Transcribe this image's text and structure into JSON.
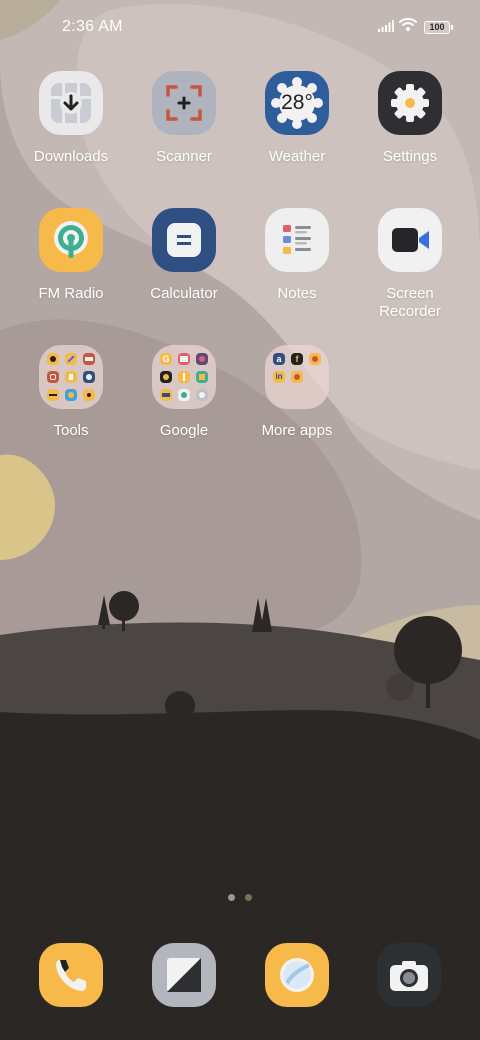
{
  "status_bar": {
    "time": "2:36 AM",
    "battery": "100",
    "icons": [
      "signal-icon",
      "wifi-icon",
      "battery-icon"
    ]
  },
  "home": {
    "apps": [
      {
        "label": "Downloads",
        "icon": "download-icon",
        "color": "#e9e9e9"
      },
      {
        "label": "Scanner",
        "icon": "scanner-icon",
        "color": "#aeb3bd"
      },
      {
        "label": "Weather",
        "icon": "weather-sun-icon",
        "color": "#2f5d9c",
        "value": "28°"
      },
      {
        "label": "Settings",
        "icon": "gear-icon",
        "color": "#2d2f33"
      },
      {
        "label": "FM Radio",
        "icon": "radio-icon",
        "color": "#f6b94a"
      },
      {
        "label": "Calculator",
        "icon": "calculator-icon",
        "color": "#2f4f82"
      },
      {
        "label": "Notes",
        "icon": "notes-icon",
        "color": "#efefef"
      },
      {
        "label": "Screen Recorder",
        "label_line1": "Screen",
        "label_line2": "Recorder",
        "icon": "video-camera-icon",
        "color": "#f1f1f1"
      }
    ],
    "folders": [
      {
        "label": "Tools"
      },
      {
        "label": "Google"
      },
      {
        "label": "More apps"
      }
    ]
  },
  "page_indicator": {
    "pages": 2,
    "current": 2
  },
  "dock": [
    {
      "name": "phone",
      "icon": "phone-icon",
      "color": "#f6b94a"
    },
    {
      "name": "gallery",
      "icon": "gallery-icon",
      "color": "#b3b6bc"
    },
    {
      "name": "browser",
      "icon": "browser-icon",
      "color": "#f6b94a"
    },
    {
      "name": "camera",
      "icon": "camera-icon",
      "color": "#2d3033"
    }
  ],
  "colors": {
    "sky": "#c8bcb8",
    "hill_mid": "#4b4643",
    "ground": "#2b2725",
    "accent_yellow": "#f6b94a"
  }
}
